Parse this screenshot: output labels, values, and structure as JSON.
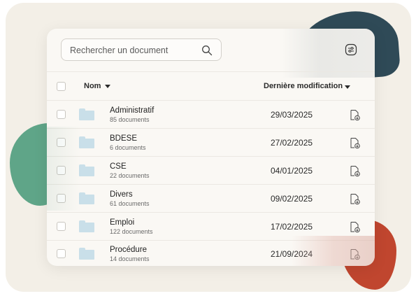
{
  "search": {
    "placeholder": "Rechercher un document"
  },
  "table": {
    "col_name": "Nom",
    "col_date": "Dernière modification",
    "rows": [
      {
        "name": "Administratif",
        "count": "85 documents",
        "date": "29/03/2025"
      },
      {
        "name": "BDESE",
        "count": "6 documents",
        "date": "27/02/2025"
      },
      {
        "name": "CSE",
        "count": "22 documents",
        "date": "04/01/2025"
      },
      {
        "name": "Divers",
        "count": "61 documents",
        "date": "09/02/2025"
      },
      {
        "name": "Emploi",
        "count": "122 documents",
        "date": "17/02/2025"
      },
      {
        "name": "Procédure",
        "count": "14 documents",
        "date": "21/09/2024"
      }
    ]
  },
  "icons": {
    "search": "search-icon",
    "filter": "filter-icon",
    "folder": "folder-icon",
    "download": "file-download-icon",
    "sort": "chevron-down-icon"
  },
  "colors": {
    "background": "#f3efe7",
    "panel": "#faf8f4",
    "folder": "#c9dfe9",
    "blob_navy": "#2f4a57",
    "blob_green": "#5fa588",
    "blob_red": "#c0462f"
  }
}
